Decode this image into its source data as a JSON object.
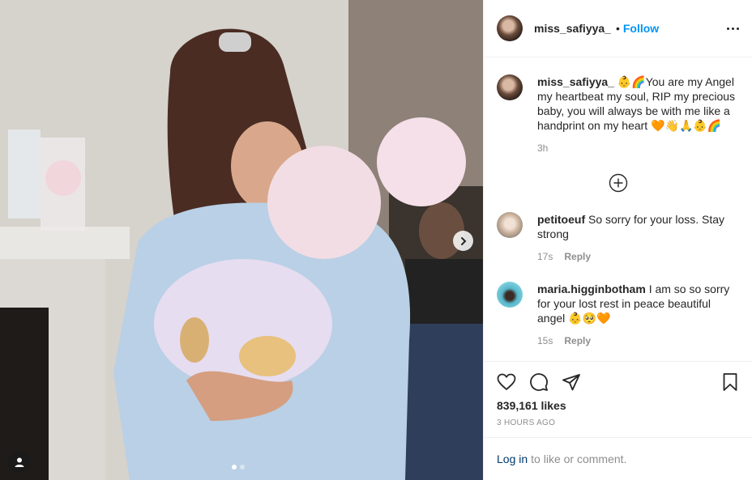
{
  "post": {
    "username": "miss_safiyya_",
    "follow_label": "Follow",
    "bullet": "•"
  },
  "caption": {
    "username": "miss_safiyya_",
    "text": "👶🌈You are my Angel my heartbeat my soul, RIP my precious baby, you will always be with me like a handprint on my heart 🧡👋🙏👶🌈",
    "time": "3h"
  },
  "comments": [
    {
      "username": "petitoeuf",
      "text": "So sorry for your loss. Stay strong",
      "time": "17s",
      "reply_label": "Reply"
    },
    {
      "username": "maria.higginbotham",
      "text": "I am so so sorry for your lost rest in peace beautiful angel 👶🥺🧡",
      "time": "15s",
      "reply_label": "Reply"
    }
  ],
  "stats": {
    "likes": "839,161 likes",
    "posted": "3 HOURS AGO"
  },
  "footer": {
    "login_link": "Log in",
    "login_rest": "to like or comment."
  },
  "icons": {
    "more": "more-horizontal-icon",
    "load_more": "circle-plus-icon",
    "like": "heart-icon",
    "comment": "comment-bubble-icon",
    "share": "paper-plane-icon",
    "save": "bookmark-icon",
    "next": "chevron-right-icon",
    "tags": "user-tag-icon"
  },
  "colors": {
    "accent": "#0095f6",
    "link": "#00376b",
    "muted": "#8e8e8e",
    "text": "#262626"
  }
}
